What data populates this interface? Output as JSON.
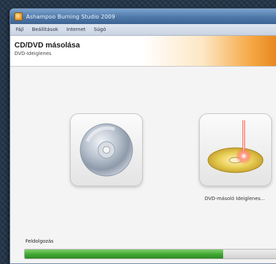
{
  "window": {
    "title": "Ashampoo Burning Studio 2009"
  },
  "menu": {
    "items": [
      "Fájl",
      "Beállítások",
      "Internet",
      "Súgó"
    ]
  },
  "header": {
    "title": "CD/DVD  másolása",
    "subtitle": "DVD-Ideiglenes"
  },
  "tiles": {
    "source_icon": "cd-disc-icon",
    "target_icon": "dvd-burn-icon",
    "target_label": "DVD-másoló Ideiglenes..."
  },
  "progress": {
    "label": "Feldolgozás",
    "value": 0.76
  },
  "colors": {
    "accent": "#e27d17",
    "progress": "#3fa532",
    "titlebar": "#4f78a8"
  }
}
